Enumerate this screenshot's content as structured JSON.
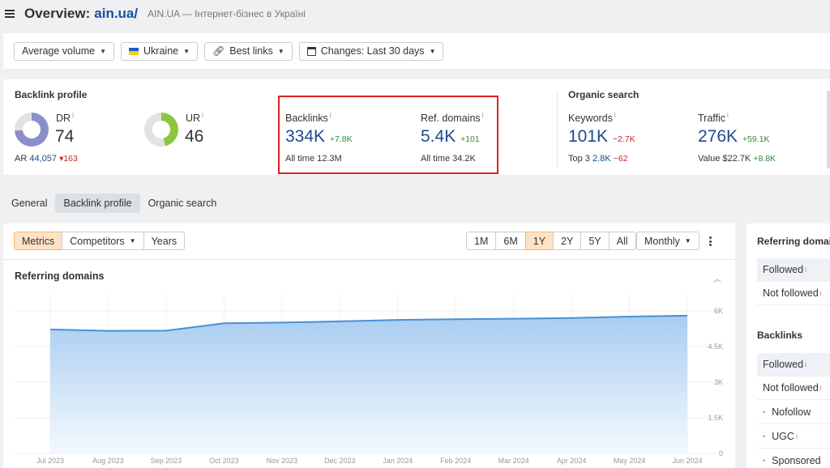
{
  "header": {
    "label": "Overview:",
    "domain": "ain.ua/",
    "subtitle": "AIN.UA — Інтернет-бізнес в Україні"
  },
  "filters": {
    "volume": "Average volume",
    "country": "Ukraine",
    "links": "Best links",
    "changes": "Changes: Last 30 days"
  },
  "backlink_profile": {
    "title": "Backlink profile",
    "dr": {
      "label": "DR",
      "value": "74",
      "fill": 0.74
    },
    "ar": {
      "label": "AR",
      "value": "44,057",
      "delta": "▾163"
    },
    "ur": {
      "label": "UR",
      "value": "46",
      "fill": 0.46
    },
    "backlinks": {
      "label": "Backlinks",
      "value": "334K",
      "delta": "+7.8K",
      "alltime_label": "All time",
      "alltime_value": "12.3M"
    },
    "ref_domains": {
      "label": "Ref. domains",
      "value": "5.4K",
      "delta": "+101",
      "alltime_label": "All time",
      "alltime_value": "34.2K"
    }
  },
  "organic_search": {
    "title": "Organic search",
    "keywords": {
      "label": "Keywords",
      "value": "101K",
      "delta": "−2.7K",
      "top3_label": "Top 3",
      "top3_value": "2.8K",
      "top3_delta": "−62"
    },
    "traffic": {
      "label": "Traffic",
      "value": "276K",
      "delta": "+59.1K",
      "value_label": "Value",
      "value_amount": "$22.7K",
      "value_delta": "+8.8K"
    }
  },
  "tabs": [
    "General",
    "Backlink profile",
    "Organic search"
  ],
  "chart_controls": {
    "views": [
      "Metrics",
      "Competitors",
      "Years"
    ],
    "periods": [
      "1M",
      "6M",
      "1Y",
      "2Y",
      "5Y",
      "All"
    ],
    "interval": "Monthly"
  },
  "chart_title": "Referring domains",
  "chart_data": {
    "type": "area",
    "title": "Referring domains",
    "x": [
      "Jul 2023",
      "Aug 2023",
      "Sep 2023",
      "Oct 2023",
      "Nov 2023",
      "Dec 2023",
      "Jan 2024",
      "Feb 2024",
      "Mar 2024",
      "Apr 2024",
      "May 2024",
      "Jun 2024"
    ],
    "y_ticks": [
      "6K",
      "4.5K",
      "3K",
      "1.5K",
      "0"
    ],
    "ylim": [
      0,
      6000
    ],
    "series": [
      {
        "values": [
          5220,
          5160,
          5170,
          5480,
          5510,
          5560,
          5620,
          5650,
          5670,
          5700,
          5760,
          5800
        ]
      }
    ],
    "colors": {
      "line": "#4a8fd6",
      "fill_top": "#a9cdf0",
      "fill_bottom": "#f4f9fe"
    },
    "grid": true
  },
  "right_panel": {
    "ref_title": "Referring domains",
    "ref_rows": [
      "Followed",
      "Not followed"
    ],
    "bl_title": "Backlinks",
    "bl_rows": [
      "Followed",
      "Not followed",
      "Nofollow",
      "UGC",
      "Sponsored"
    ]
  }
}
